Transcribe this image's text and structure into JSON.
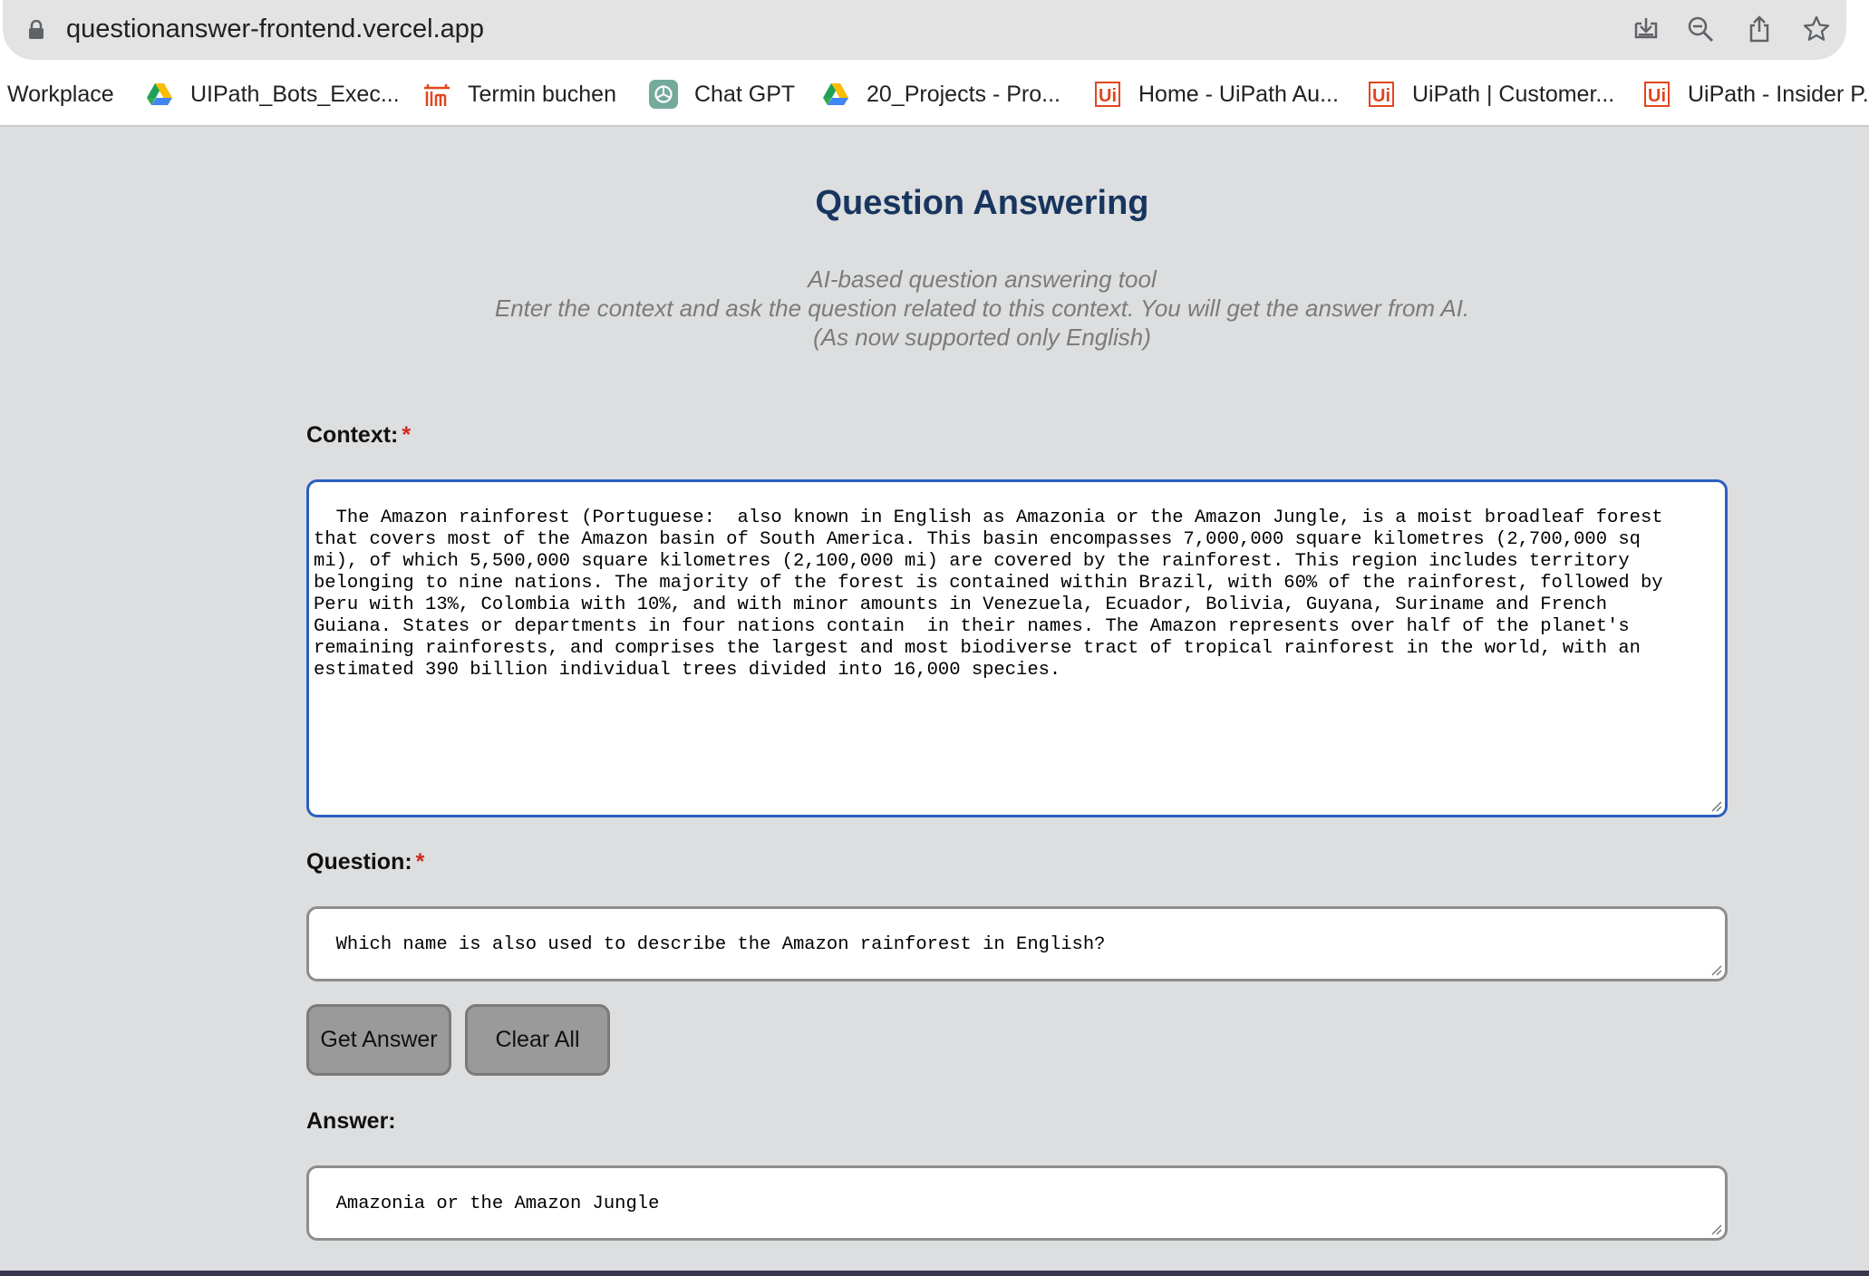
{
  "browser": {
    "url": "questionanswer-frontend.vercel.app",
    "bookmarks": [
      {
        "label": "Workplace",
        "icon": "none"
      },
      {
        "label": "UIPath_Bots_Exec...",
        "icon": "google-drive-icon"
      },
      {
        "label": "Termin buchen",
        "icon": "termin-icon"
      },
      {
        "label": "Chat GPT",
        "icon": "chatgpt-icon"
      },
      {
        "label": "20_Projects - Pro...",
        "icon": "google-drive-icon"
      },
      {
        "label": "Home - UiPath Au...",
        "icon": "uipath-icon"
      },
      {
        "label": "UiPath | Customer...",
        "icon": "uipath-icon"
      },
      {
        "label": "UiPath - Insider P...",
        "icon": "uipath-icon"
      }
    ],
    "uipath_icon_text": "Ui",
    "toolbar_icons": [
      "install-app-icon",
      "zoom-out-icon",
      "share-icon",
      "bookmark-star-icon"
    ]
  },
  "page": {
    "title": "Question Answering",
    "subtitle_lines": [
      "AI-based question answering tool",
      "Enter the context and ask the question related to this context. You will get the answer from AI.",
      "(As now supported only English)"
    ],
    "context_label": "Context:",
    "required_mark": "*",
    "context_value": "The Amazon rainforest (Portuguese:  also known in English as Amazonia or the Amazon Jungle, is a moist broadleaf forest\nthat covers most of the Amazon basin of South America. This basin encompasses 7,000,000 square kilometres (2,700,000 sq\nmi), of which 5,500,000 square kilometres (2,100,000 mi) are covered by the rainforest. This region includes territory\nbelonging to nine nations. The majority of the forest is contained within Brazil, with 60% of the rainforest, followed by\nPeru with 13%, Colombia with 10%, and with minor amounts in Venezuela, Ecuador, Bolivia, Guyana, Suriname and French\nGuiana. States or departments in four nations contain  in their names. The Amazon represents over half of the planet's\nremaining rainforests, and comprises the largest and most biodiverse tract of tropical rainforest in the world, with an\nestimated 390 billion individual trees divided into 16,000 species.",
    "question_label": "Question:",
    "question_value": "Which name is also used to describe the Amazon rainforest in English?",
    "get_answer_label": "Get Answer",
    "clear_all_label": "Clear All",
    "answer_label": "Answer:",
    "answer_value": "Amazonia or the Amazon Jungle"
  },
  "colors": {
    "title": "#17355e",
    "required": "#d0281f",
    "focus_border": "#2b5fc1",
    "page_bg": "#dcdedf",
    "button_bg": "#9a9a9a"
  }
}
